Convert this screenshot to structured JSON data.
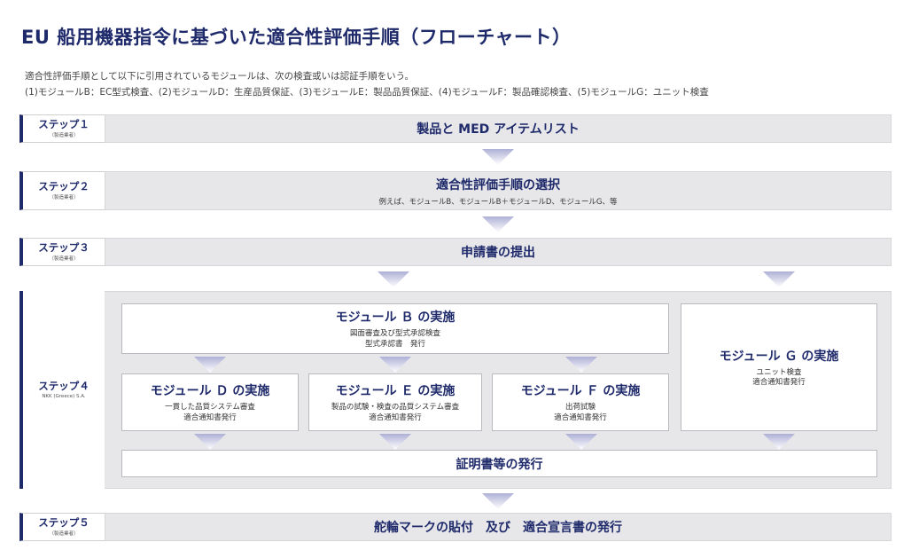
{
  "title": "EU 船用機器指令に基づいた適合性評価手順（フローチャート）",
  "intro": {
    "line1": "適合性評価手順として以下に引用されているモジュールは、次の検査或いは認証手順をいう。",
    "line2": "(1)モジュールB：EC型式検査、(2)モジュールD：生産品質保証、(3)モジュールE：製品品質保証、(4)モジュールF：製品確認検査、(5)モジュールG：ユニット検査"
  },
  "steps": [
    {
      "name": "ステップ１",
      "sub": "（製造業者）",
      "title": "製品と MED アイテムリスト",
      "desc": ""
    },
    {
      "name": "ステップ２",
      "sub": "（製造業者）",
      "title": "適合性評価手順の選択",
      "desc": "例えば、モジュールB、モジュールB＋モジュールD、モジュールG、等"
    },
    {
      "name": "ステップ３",
      "sub": "（製造業者）",
      "title": "申請書の提出",
      "desc": ""
    },
    {
      "name": "ステップ４",
      "sub": "NKK (Greece) S.A."
    },
    {
      "name": "ステップ５",
      "sub": "（製造業者）",
      "title": "舵輪マークの貼付　及び　適合宣言書の発行",
      "desc": ""
    }
  ],
  "modules": {
    "b": {
      "title": "モジュール Ｂ の実施",
      "desc1": "図面審査及び型式承認検査",
      "desc2": "型式承認書　発行"
    },
    "g": {
      "title": "モジュール Ｇ の実施",
      "desc1": "ユニット検査",
      "desc2": "適合通知書発行"
    },
    "d": {
      "title": "モジュール Ｄ の実施",
      "desc1": "一貫した品質システム審査",
      "desc2": "適合通知書発行"
    },
    "e": {
      "title": "モジュール Ｅ の実施",
      "desc1": "製品の試験・検査の品質システム審査",
      "desc2": "適合通知書発行"
    },
    "f": {
      "title": "モジュール Ｆ の実施",
      "desc1": "出荷試験",
      "desc2": "適合通知書発行"
    },
    "certificate": {
      "title": "証明書等の発行"
    }
  },
  "colors": {
    "navy": "#1f2a6b",
    "band": "#e7e7ea",
    "arrow_top": "#aeb0d6",
    "arrow_bottom": "#ffffff"
  }
}
